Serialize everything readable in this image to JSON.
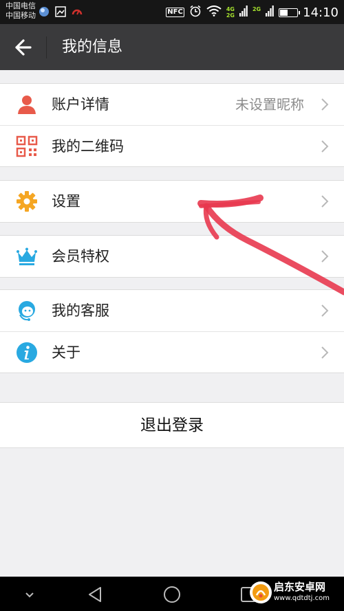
{
  "status_bar": {
    "carrier_1": "中国电信",
    "carrier_2": "中国移动",
    "nfc": "NFC",
    "net_4g": "4G",
    "net_2g_a": "2G",
    "net_2g_b": "2G",
    "time": "14:10",
    "battery_level": 0.45
  },
  "header": {
    "title": "我的信息"
  },
  "menu": {
    "account": {
      "label": "账户详情",
      "value": "未设置昵称"
    },
    "qrcode": {
      "label": "我的二维码"
    },
    "settings": {
      "label": "设置"
    },
    "vip": {
      "label": "会员特权"
    },
    "service": {
      "label": "我的客服"
    },
    "about": {
      "label": "关于"
    }
  },
  "logout_label": "退出登录",
  "watermark": {
    "name": "启东安卓网",
    "url": "www.qdtdtj.com"
  },
  "colors": {
    "title_bar": "#3a3a3c",
    "account_icon": "#e85a4a",
    "qrcode_icon": "#e85a4a",
    "settings_icon": "#f5a623",
    "vip_icon": "#29a9e1",
    "service_icon": "#29a9e1",
    "about_icon": "#29a9e1",
    "annotation_arrow": "#e8384f"
  }
}
